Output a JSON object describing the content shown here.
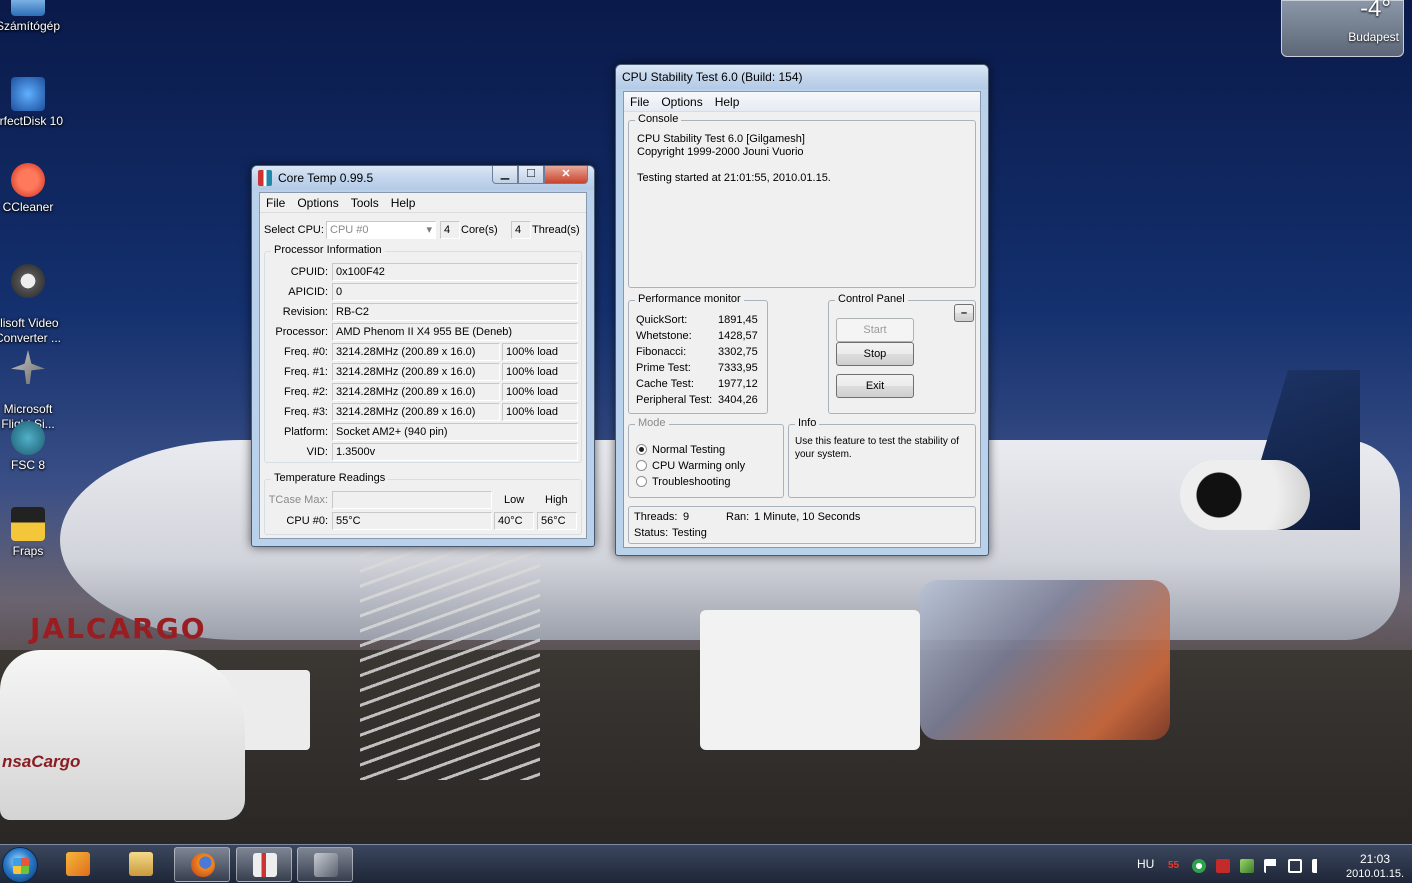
{
  "desktop": {
    "icons": [
      {
        "label": "Számítógép"
      },
      {
        "label": "erfectDisk 10"
      },
      {
        "label": "CCleaner"
      },
      {
        "label": "ilisoft Video\nConverter ..."
      },
      {
        "label": "Microsoft\nFlight Si..."
      },
      {
        "label": "FSC 8"
      },
      {
        "label": "Fraps"
      }
    ],
    "wallpaper_text": "JALCARGO",
    "van_text": "nsaCargo"
  },
  "weather": {
    "temp": "-4°",
    "city": "Budapest"
  },
  "coretemp": {
    "title": "Core Temp 0.99.5",
    "menu": [
      "File",
      "Options",
      "Tools",
      "Help"
    ],
    "select_cpu_label": "Select CPU:",
    "select_cpu_value": "CPU #0",
    "cores_value": "4",
    "cores_label": "Core(s)",
    "threads_value": "4",
    "threads_label": "Thread(s)",
    "processor_info_label": "Processor Information",
    "rows": [
      {
        "label": "CPUID:",
        "value": "0x100F42"
      },
      {
        "label": "APICID:",
        "value": "0"
      },
      {
        "label": "Revision:",
        "value": "RB-C2"
      },
      {
        "label": "Processor:",
        "value": "AMD Phenom II X4 955 BE (Deneb)"
      },
      {
        "label": "Freq. #0:",
        "value": "3214.28MHz (200.89 x 16.0)",
        "load": "100% load"
      },
      {
        "label": "Freq. #1:",
        "value": "3214.28MHz (200.89 x 16.0)",
        "load": "100% load"
      },
      {
        "label": "Freq. #2:",
        "value": "3214.28MHz (200.89 x 16.0)",
        "load": "100% load"
      },
      {
        "label": "Freq. #3:",
        "value": "3214.28MHz (200.89 x 16.0)",
        "load": "100% load"
      },
      {
        "label": "Platform:",
        "value": "Socket AM2+ (940 pin)"
      },
      {
        "label": "VID:",
        "value": "1.3500v"
      }
    ],
    "temp_readings_label": "Temperature Readings",
    "tcase_label": "TCase Max:",
    "tcase_value": "",
    "low_label": "Low",
    "high_label": "High",
    "cpu0_label": "CPU #0:",
    "cpu0_temp": "55°C",
    "cpu0_low": "40°C",
    "cpu0_high": "56°C"
  },
  "cst": {
    "title": "CPU Stability Test 6.0 (Build: 154)",
    "menu": [
      "File",
      "Options",
      "Help"
    ],
    "console_label": "Console",
    "console_lines": [
      "CPU Stability Test 6.0 [Gilgamesh]",
      "Copyright 1999-2000 Jouni Vuorio",
      "",
      "Testing started at 21:01:55, 2010.01.15."
    ],
    "perf_label": "Performance monitor",
    "perf": [
      {
        "name": "QuickSort:",
        "value": "1891,45"
      },
      {
        "name": "Whetstone:",
        "value": "1428,57"
      },
      {
        "name": "Fibonacci:",
        "value": "3302,75"
      },
      {
        "name": "Prime Test:",
        "value": "7333,95"
      },
      {
        "name": "Cache Test:",
        "value": "1977,12"
      },
      {
        "name": "Peripheral Test:",
        "value": "3404,26"
      }
    ],
    "control_label": "Control Panel",
    "collapse_label": "–",
    "start_label": "Start",
    "stop_label": "Stop",
    "exit_label": "Exit",
    "mode_label": "Mode",
    "modes": [
      "Normal Testing",
      "CPU Warming only",
      "Troubleshooting"
    ],
    "mode_selected": 0,
    "info_label": "Info",
    "info_text": "Use this feature to test the stability of your system.",
    "threads_label": "Threads:",
    "threads_value": "9",
    "ran_label": "Ran:",
    "ran_value": "1 Minute, 10 Seconds",
    "status_label": "Status:",
    "status_value": "Testing"
  },
  "taskbar": {
    "lang": "HU",
    "temp_tray": "55",
    "time": "21:03",
    "date": "2010.01.15."
  }
}
